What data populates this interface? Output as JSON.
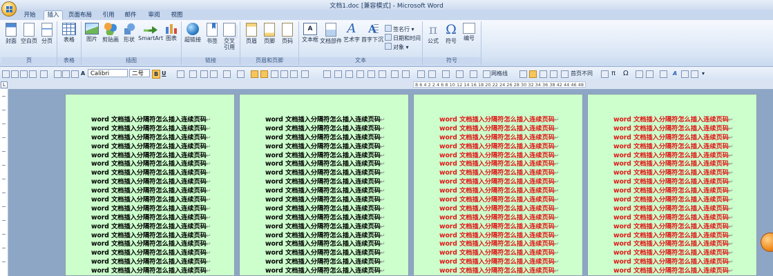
{
  "window": {
    "title": "文档1.doc [兼容模式] - Microsoft Word"
  },
  "tabs": [
    {
      "label": "开始",
      "active": false
    },
    {
      "label": "插入",
      "active": true
    },
    {
      "label": "页面布局",
      "active": false
    },
    {
      "label": "引用",
      "active": false
    },
    {
      "label": "邮件",
      "active": false
    },
    {
      "label": "审阅",
      "active": false
    },
    {
      "label": "视图",
      "active": false
    }
  ],
  "ribbon": {
    "groups": {
      "pages": "页",
      "tables": "表格",
      "illustrations": "插图",
      "links": "链接",
      "header_footer": "页眉和页脚",
      "text": "文本",
      "symbols": "符号"
    },
    "buttons": {
      "cover": "封面",
      "blank_page": "空白页",
      "page_break": "分页",
      "table": "表格",
      "picture": "图片",
      "clipart": "剪贴画",
      "shapes": "形状",
      "smartart": "SmartArt",
      "chart": "图表",
      "hyperlink": "超链接",
      "bookmark": "书签",
      "cross_ref_line1": "交叉",
      "cross_ref_line2": "引用",
      "header": "页眉",
      "footer": "页脚",
      "page_number": "页码",
      "textbox": "文本框",
      "quick_parts": "文档部件",
      "wordart": "艺术字",
      "dropcap": "首字下沉",
      "signature_line": "签名行",
      "date_time": "日期和时间",
      "object": "对象",
      "equation": "公式",
      "symbol": "符号",
      "number": "编号"
    }
  },
  "format_toolbar": {
    "font_name": "Calibri",
    "font_size": "二号",
    "bold": "B",
    "underline": "U",
    "gridlines": "网格线",
    "different_first_page": "首页不同",
    "pi": "π",
    "omega": "Ω",
    "letter_a": "A",
    "italic_a": "A"
  },
  "ruler": {
    "text": "8  6  4  2     2  4  6  8  10  12  14  16  18  20  22  24  26  28  30  32  34  36  38     42  44  46  48"
  },
  "document": {
    "line_text": "word 文档插入分隔符怎么插入连续页码",
    "para_mark": "↵",
    "pages": [
      {
        "color": "black",
        "line_count": 18
      },
      {
        "color": "black",
        "line_count": 18
      },
      {
        "color": "red",
        "line_count": 18
      },
      {
        "color": "red",
        "line_count": 18
      }
    ]
  },
  "colors": {
    "page_background": "#ccffcc",
    "red_text": "#e01818",
    "workspace": "#8ea6c6",
    "active_tab": "#f4f8fd"
  }
}
